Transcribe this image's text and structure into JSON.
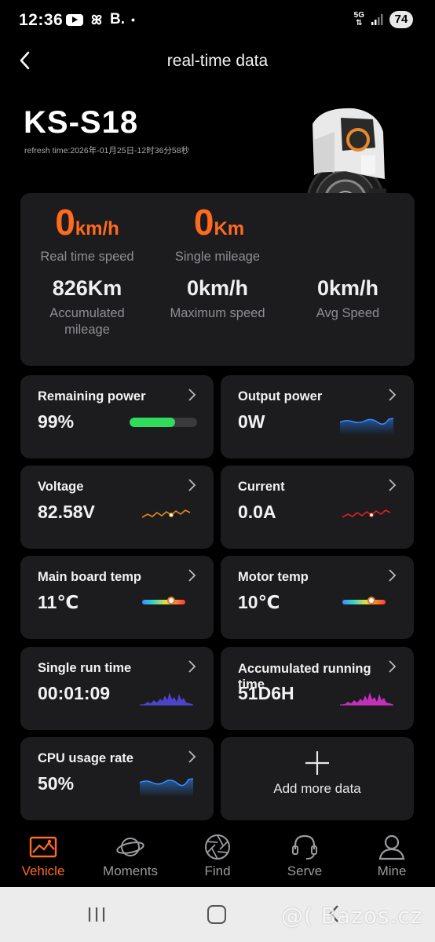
{
  "status_bar": {
    "time": "12:36",
    "indicator_b": "B.",
    "dot": "•",
    "network_top": "5G",
    "network_bottom": "⇅",
    "battery": "74"
  },
  "header": {
    "title": "real-time data"
  },
  "vehicle": {
    "model": "KS-S18",
    "refresh_time": "refresh time:2026年-01月25日-12时36分58秒"
  },
  "stats": {
    "speed": {
      "value": "0",
      "unit": "km/h",
      "label": "Real time speed"
    },
    "single_mileage": {
      "value": "0",
      "unit": "Km",
      "label": "Single mileage"
    },
    "accumulated": {
      "value": "826Km",
      "label": "Accumulated mileage"
    },
    "max_speed": {
      "value": "0km/h",
      "label": "Maximum speed"
    },
    "avg_speed": {
      "value": "0km/h",
      "label": "Avg Speed"
    }
  },
  "tiles": {
    "remaining_power": {
      "title": "Remaining power",
      "value": "99%",
      "level": 0.68
    },
    "output_power": {
      "title": "Output power",
      "value": "0W"
    },
    "voltage": {
      "title": "Voltage",
      "value": "82.58V"
    },
    "current": {
      "title": "Current",
      "value": "0.0A"
    },
    "main_board_temp": {
      "title": "Main board temp",
      "value": "11℃",
      "level": 0.68
    },
    "motor_temp": {
      "title": "Motor temp",
      "value": "10℃",
      "level": 0.68
    },
    "single_run_time": {
      "title": "Single run time",
      "value": "00:01:09"
    },
    "accumulated_running_time": {
      "title": "Accumulated running time",
      "value": "51D6H"
    },
    "cpu_usage": {
      "title": "CPU usage rate",
      "value": "50%"
    },
    "add_more": {
      "label": "Add more data"
    }
  },
  "colors": {
    "accent": "#ff6a1f",
    "battery_green": "#2fdc5c",
    "output_blue": "#1f6fd6",
    "voltage_orange": "#e08a1e",
    "current_red": "#e02020",
    "runtime_indigo": "#4b44c8",
    "accum_magenta": "#c030b8",
    "cpu_blue": "#2a7ad8"
  },
  "tabs": [
    {
      "label": "Vehicle",
      "icon": "vehicle-icon",
      "active": true
    },
    {
      "label": "Moments",
      "icon": "planet-icon",
      "active": false
    },
    {
      "label": "Find",
      "icon": "aperture-icon",
      "active": false
    },
    {
      "label": "Serve",
      "icon": "headset-icon",
      "active": false
    },
    {
      "label": "Mine",
      "icon": "user-icon",
      "active": false
    }
  ],
  "watermark": "@( Bazos.cz"
}
